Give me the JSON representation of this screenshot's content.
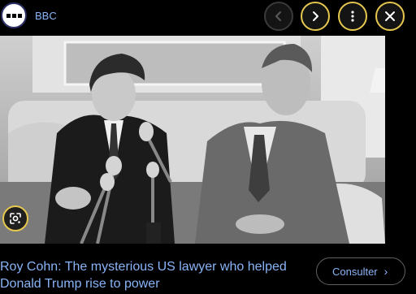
{
  "header": {
    "source_name": "BBC",
    "logo_icon": "bbc-logo-icon",
    "buttons": {
      "prev_icon": "chevron-left-icon",
      "next_icon": "chevron-right-icon",
      "more_icon": "more-vert-icon",
      "close_icon": "close-icon"
    }
  },
  "image": {
    "lens_icon": "google-lens-icon",
    "style": "black-and-white photograph"
  },
  "caption": {
    "title": "Roy Cohn: The mysterious US lawyer who helped Donald Trump rise to power"
  },
  "visit_button": {
    "label": "Consulter",
    "icon": "chevron-right-icon"
  },
  "colors": {
    "background": "#000000",
    "link": "#8ab4f8",
    "focus_ring": "#e6c84f"
  }
}
